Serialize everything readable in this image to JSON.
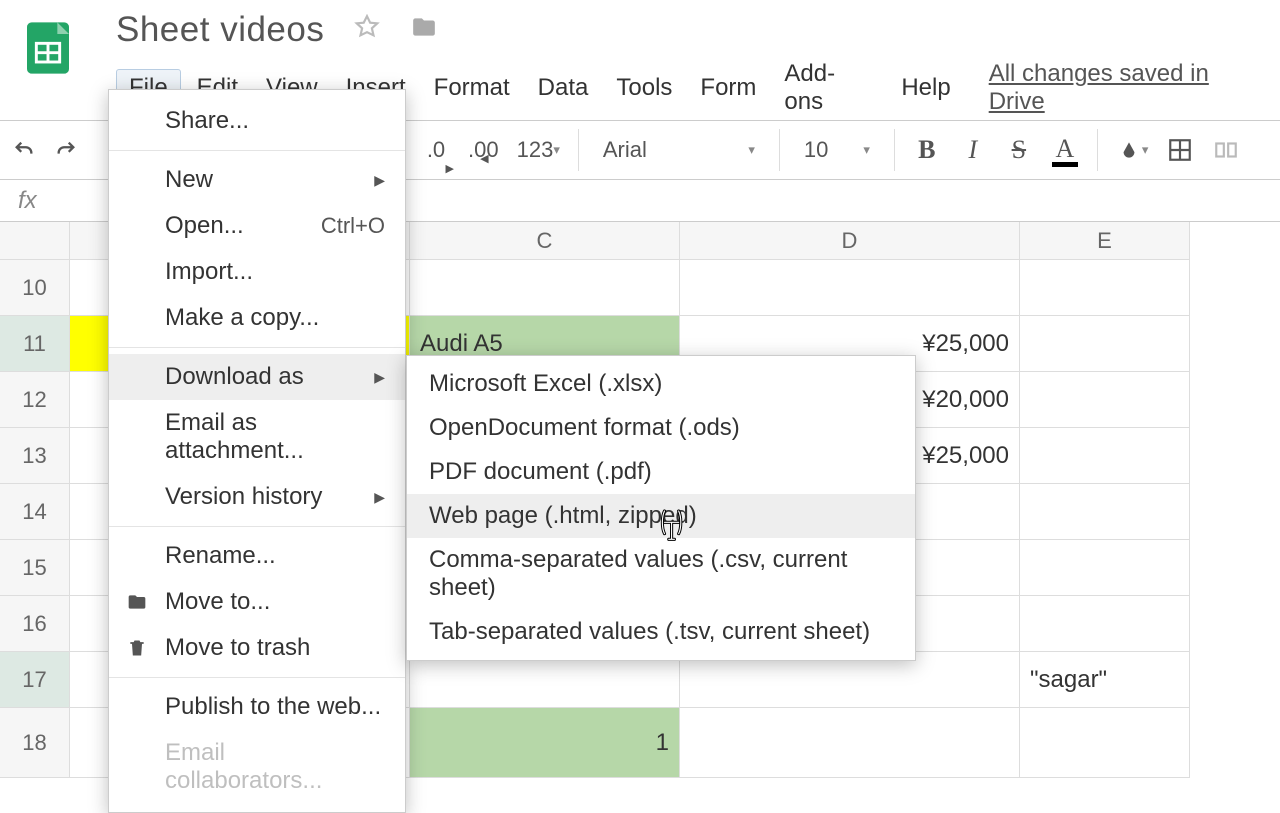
{
  "doc": {
    "title": "Sheet videos",
    "saved": "All changes saved in Drive"
  },
  "menubar": {
    "file": "File",
    "edit": "Edit",
    "view": "View",
    "insert": "Insert",
    "format": "Format",
    "data": "Data",
    "tools": "Tools",
    "form": "Form",
    "addons": "Add-ons",
    "help": "Help"
  },
  "toolbar": {
    "percent": "%",
    "dec_less": ".0",
    "dec_more": ".00",
    "numfmt": "123",
    "font": "Arial",
    "size": "10",
    "bold": "B",
    "italic": "I",
    "strike": "S",
    "textcolor": "A"
  },
  "fx": {
    "label": "fx"
  },
  "columns": {
    "c": "C",
    "d": "D",
    "e": "E"
  },
  "rows": {
    "r10": "10",
    "r11": "11",
    "r12": "12",
    "r13": "13",
    "r14": "14",
    "r15": "15",
    "r16": "16",
    "r17": "17",
    "r18": "18"
  },
  "cells": {
    "c11_val": "Audi A5",
    "d11_val": "¥25,000",
    "d12_val": "¥20,000",
    "d13_val": "¥25,000",
    "d17_val": "\"sagar\"",
    "c18_val": "1"
  },
  "fileMenu": {
    "share": "Share...",
    "new": "New",
    "open": "Open...",
    "open_sc": "Ctrl+O",
    "import": "Import...",
    "make_copy": "Make a copy...",
    "download_as": "Download as",
    "email_attach": "Email as attachment...",
    "version_history": "Version history",
    "rename": "Rename...",
    "move_to": "Move to...",
    "move_trash": "Move to trash",
    "publish_web": "Publish to the web...",
    "email_collab": "Email collaborators..."
  },
  "downloadMenu": {
    "xlsx": "Microsoft Excel (.xlsx)",
    "ods": "OpenDocument format (.ods)",
    "pdf": "PDF document (.pdf)",
    "html": "Web page (.html, zipped)",
    "csv": "Comma-separated values (.csv, current sheet)",
    "tsv": "Tab-separated values (.tsv, current sheet)"
  }
}
